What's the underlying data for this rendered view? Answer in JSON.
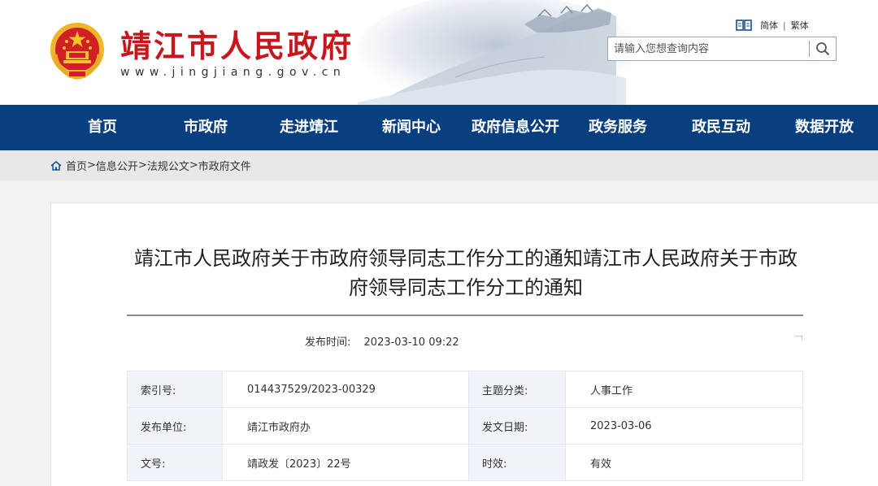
{
  "header": {
    "site_title": "靖江市人民政府",
    "site_url": "www.jingjiang.gov.cn",
    "lang_simplified": "简体",
    "lang_separator": "|",
    "lang_traditional": "繁体",
    "search_placeholder": "请输入您想查询内容",
    "search_value": "",
    "colors": {
      "brand_red": "#c8161d",
      "nav_blue": "#0a3f7f"
    }
  },
  "nav": {
    "items": [
      "首页",
      "市政府",
      "走进靖江",
      "新闻中心",
      "政府信息公开",
      "政务服务",
      "政民互动",
      "数据开放"
    ]
  },
  "breadcrumb": {
    "items": [
      "首页",
      "信息公开",
      "法规公文",
      "市政府文件"
    ],
    "separator": ">"
  },
  "article": {
    "title": "靖江市人民政府关于市政府领导同志工作分工的通知靖江市人民政府关于市政府领导同志工作分工的通知",
    "publish_label": "发布时间:",
    "publish_time": "2023-03-10 09:22"
  },
  "meta": {
    "rows": [
      {
        "k1": "索引号:",
        "v1": "014437529/2023-00329",
        "k2": "主题分类:",
        "v2": "人事工作"
      },
      {
        "k1": "发布单位:",
        "v1": "靖江市政府办",
        "k2": "发文日期:",
        "v2": "2023-03-06"
      },
      {
        "k1": "文号:",
        "v1": "靖政发〔2023〕22号",
        "k2": "时效:",
        "v2": "有效"
      }
    ]
  },
  "icons": {
    "emblem": "national-emblem-icon",
    "language": "book-icon",
    "search": "search-icon",
    "home": "home-icon"
  }
}
